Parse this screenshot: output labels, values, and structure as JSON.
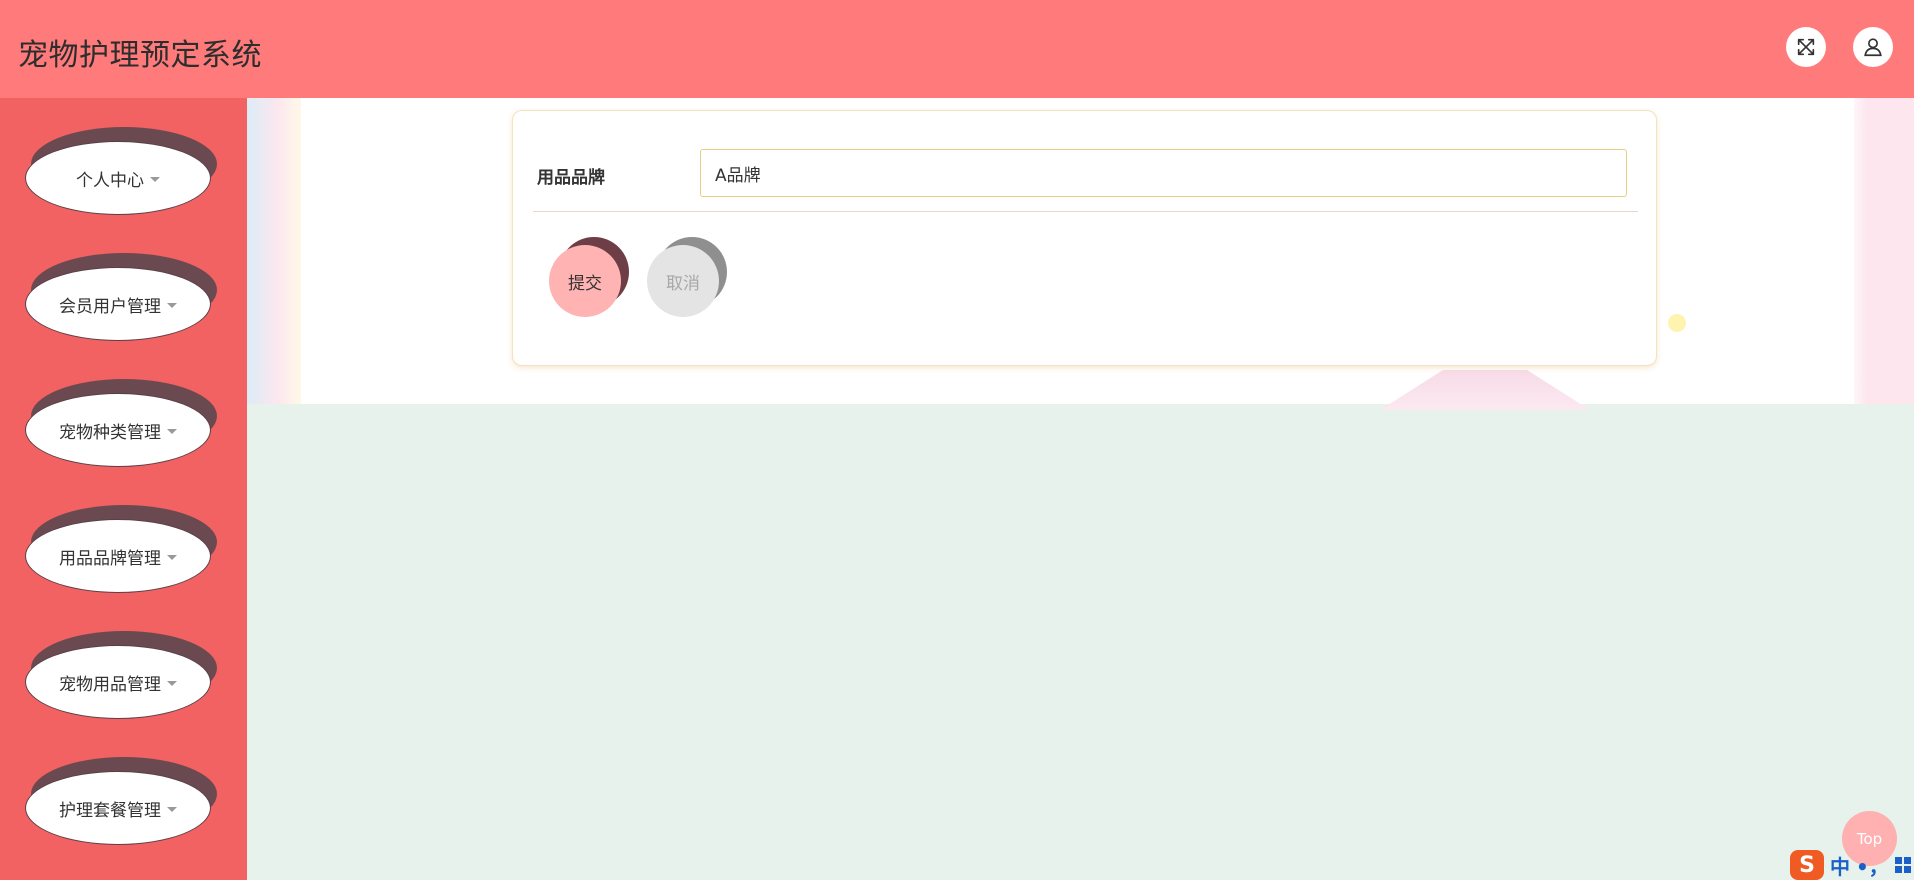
{
  "header": {
    "title": "宠物护理预定系统",
    "fullscreen_icon": "expand-arrows-icon",
    "user_icon": "user-icon"
  },
  "sidebar": {
    "items": [
      {
        "label": "个人中心"
      },
      {
        "label": "会员用户管理"
      },
      {
        "label": "宠物种类管理"
      },
      {
        "label": "用品品牌管理"
      },
      {
        "label": "宠物用品管理"
      },
      {
        "label": "护理套餐管理"
      }
    ]
  },
  "form": {
    "field_label": "用品品牌",
    "field_value": "A品牌",
    "submit_label": "提交",
    "cancel_label": "取消"
  },
  "back_to_top": {
    "label": "Top"
  },
  "ime": {
    "logo": "S",
    "mode": "中",
    "punct": "•，"
  },
  "colors": {
    "header": "#ff7a7a",
    "sidebar": "#f26262",
    "submit": "#ffb3b3",
    "cancel": "#e4e4e4",
    "page_bg": "#e6f2eb"
  }
}
